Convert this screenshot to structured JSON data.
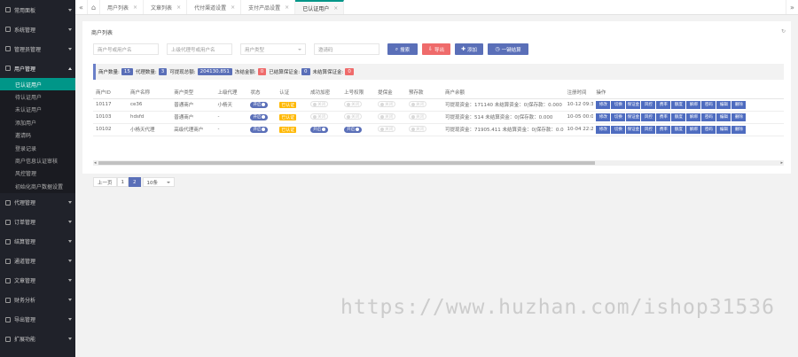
{
  "sidebar": {
    "items": [
      {
        "label": "常用面板"
      },
      {
        "label": "系统管理"
      },
      {
        "label": "管理员管理"
      },
      {
        "label": "用户管理",
        "open": true
      }
    ],
    "sub_items": [
      {
        "label": "已认证用户",
        "active": true
      },
      {
        "label": "待认证用户"
      },
      {
        "label": "未认证用户"
      },
      {
        "label": "添加用户"
      },
      {
        "label": "邀请码"
      },
      {
        "label": "登录记录"
      },
      {
        "label": "商户信息认证审核"
      },
      {
        "label": "风控管理"
      },
      {
        "label": "初始化商户数据设置"
      }
    ],
    "items_after": [
      {
        "label": "代理管理"
      },
      {
        "label": "订单管理"
      },
      {
        "label": "结算管理"
      },
      {
        "label": "通道管理"
      },
      {
        "label": "文章管理"
      },
      {
        "label": "财务分析"
      },
      {
        "label": "导出管理"
      },
      {
        "label": "扩展功能"
      }
    ]
  },
  "topbar": {
    "left_icon": "«",
    "home_icon": "⌂",
    "right_icon": "»",
    "close_glyph": "×",
    "tabs": [
      {
        "label": "用户列表"
      },
      {
        "label": "文章列表"
      },
      {
        "label": "代付渠道设置"
      },
      {
        "label": "支付产品设置"
      },
      {
        "label": "已认证用户",
        "active": true
      }
    ]
  },
  "panel": {
    "title": "商户列表",
    "refresh_icon": "↻"
  },
  "filters": {
    "merchant_placeholder": "商户号或用户名",
    "agent_placeholder": "上级代理号或用户名",
    "user_type_placeholder": "用户类型",
    "invite_placeholder": "邀请码"
  },
  "buttons": {
    "search": "搜索",
    "export": "导出",
    "add": "添加",
    "settle": "一键结算",
    "search_icon": "⌕",
    "export_icon": "⇩",
    "add_icon": "✚",
    "settle_icon": "◷"
  },
  "stats": [
    {
      "label": "商户数量:",
      "value": "15",
      "color": "#5a6fb8"
    },
    {
      "label": "代理数量:",
      "value": "3",
      "color": "#5a6fb8"
    },
    {
      "label": "可提现总额:",
      "value": "204130.851",
      "color": "#5a6fb8"
    },
    {
      "label": "冻结金额:",
      "value": "0",
      "color": "#ef6b6b"
    },
    {
      "label": "已结算保证金:",
      "value": "0",
      "color": "#5a6fb8"
    },
    {
      "label": "未结算保证金:",
      "value": "0",
      "color": "#ef6b6b"
    }
  ],
  "table": {
    "headers": [
      "商户ID",
      "商户名称",
      "商户类型",
      "上级代理",
      "状态",
      "认证",
      "成功加密",
      "上号权限",
      "提保金",
      "预存款",
      "商户余额",
      "注册时间",
      "操作"
    ],
    "rows": [
      {
        "id": "10117",
        "name": "ce36",
        "type": "普通商户",
        "agent": "小杨天",
        "status": "开启",
        "status_on": true,
        "auth": "已认证",
        "enc": "关闭",
        "enc_on": false,
        "perm": "关闭",
        "perm_on": false,
        "deposit": "关闭",
        "deposit_on": false,
        "prepay": "关闭",
        "prepay_on": false,
        "balance": "可提现资金：171140 未结算资金：0|保存款：0.000",
        "time": "10-12 09:3"
      },
      {
        "id": "10103",
        "name": "hdsfd",
        "type": "普通商户",
        "agent": "-",
        "status": "开启",
        "status_on": true,
        "auth": "已认证",
        "enc": "关闭",
        "enc_on": false,
        "perm": "关闭",
        "perm_on": false,
        "deposit": "关闭",
        "deposit_on": false,
        "prepay": "关闭",
        "prepay_on": false,
        "balance": "可提现资金：514 未结算资金：0|保存款：0.000",
        "time": "10-05 00:0"
      },
      {
        "id": "10102",
        "name": "小杨天代理",
        "type": "高级代理商户",
        "agent": "-",
        "status": "开启",
        "status_on": true,
        "auth": "已认证",
        "enc": "开启",
        "enc_on": true,
        "perm": "开启",
        "perm_on": true,
        "deposit": "关闭",
        "deposit_on": false,
        "prepay": "关闭",
        "prepay_on": false,
        "balance": "可提现资金：71905.411 未结算资金：0|保存款：0.0",
        "time": "10-04 22:2"
      }
    ],
    "op_labels": [
      "修改",
      "切换",
      "保证金",
      "风控",
      "费率",
      "额度",
      "解绑",
      "密码",
      "编辑",
      "删除"
    ]
  },
  "pager": {
    "prev": "上一页",
    "pages": [
      "1",
      "2"
    ],
    "current": "2",
    "page_size": "10条",
    "scroll_left": "◂",
    "scroll_right": "▸"
  },
  "watermark": "https://www.huzhan.com/ishop31536",
  "colors": {
    "accent": "#5a6fb8",
    "active_menu": "#009688",
    "danger": "#ef6b6b",
    "warn": "#ffb800",
    "sidebar_bg": "#20222a"
  }
}
